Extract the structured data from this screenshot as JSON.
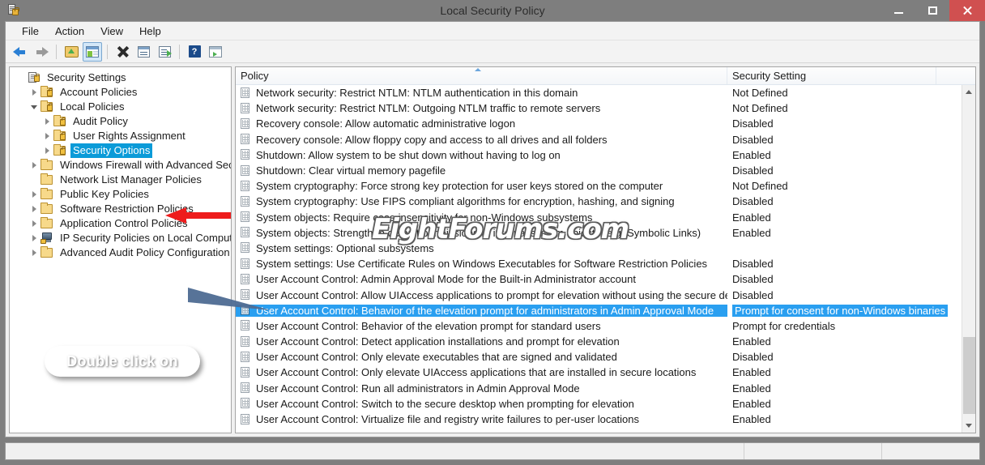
{
  "window": {
    "title": "Local Security Policy",
    "icon": "security-policy-icon",
    "minimize_label": "Minimize",
    "maximize_label": "Maximize",
    "close_label": "Close"
  },
  "menubar": {
    "items": [
      {
        "label": "File"
      },
      {
        "label": "Action"
      },
      {
        "label": "View"
      },
      {
        "label": "Help"
      }
    ]
  },
  "toolbar": {
    "buttons": [
      {
        "name": "back-button",
        "icon": "back-arrow-icon"
      },
      {
        "name": "forward-button",
        "icon": "forward-arrow-icon"
      },
      {
        "name": "up-one-level-button",
        "icon": "folder-up-icon"
      },
      {
        "name": "show-hide-tree-button",
        "icon": "console-tree-icon",
        "pressed": true
      },
      {
        "name": "delete-button",
        "icon": "delete-x-icon"
      },
      {
        "name": "properties-button",
        "icon": "properties-icon"
      },
      {
        "name": "export-list-button",
        "icon": "export-list-icon"
      },
      {
        "name": "help-button",
        "icon": "help-question-icon"
      },
      {
        "name": "new-window-button",
        "icon": "new-window-icon"
      }
    ]
  },
  "tree": {
    "nodes": [
      {
        "label": "Security Settings",
        "depth": 0,
        "twist": "none",
        "icon": "security-settings-icon",
        "selected": false
      },
      {
        "label": "Account Policies",
        "depth": 1,
        "twist": "closed",
        "icon": "policy-folder-icon",
        "selected": false
      },
      {
        "label": "Local Policies",
        "depth": 1,
        "twist": "open",
        "icon": "policy-folder-icon",
        "selected": false
      },
      {
        "label": "Audit Policy",
        "depth": 2,
        "twist": "closed",
        "icon": "policy-folder-icon",
        "selected": false
      },
      {
        "label": "User Rights Assignment",
        "depth": 2,
        "twist": "closed",
        "icon": "policy-folder-icon",
        "selected": false
      },
      {
        "label": "Security Options",
        "depth": 2,
        "twist": "closed",
        "icon": "policy-folder-icon",
        "selected": true
      },
      {
        "label": "Windows Firewall with Advanced Security",
        "depth": 1,
        "twist": "closed",
        "icon": "folder-icon",
        "selected": false
      },
      {
        "label": "Network List Manager Policies",
        "depth": 1,
        "twist": "none",
        "icon": "folder-icon",
        "selected": false
      },
      {
        "label": "Public Key Policies",
        "depth": 1,
        "twist": "closed",
        "icon": "folder-icon",
        "selected": false
      },
      {
        "label": "Software Restriction Policies",
        "depth": 1,
        "twist": "closed",
        "icon": "folder-icon",
        "selected": false
      },
      {
        "label": "Application Control Policies",
        "depth": 1,
        "twist": "closed",
        "icon": "folder-icon",
        "selected": false
      },
      {
        "label": "IP Security Policies on Local Computer",
        "depth": 1,
        "twist": "closed",
        "icon": "computer-key-icon",
        "selected": false
      },
      {
        "label": "Advanced Audit Policy Configuration",
        "depth": 1,
        "twist": "closed",
        "icon": "folder-icon",
        "selected": false
      }
    ]
  },
  "list": {
    "columns": [
      {
        "label": "Policy",
        "sorted": "ascending"
      },
      {
        "label": "Security Setting",
        "sorted": "none"
      }
    ],
    "rows": [
      {
        "policy": "Network security: Restrict NTLM: NTLM authentication in this domain",
        "setting": "Not Defined",
        "selected": false
      },
      {
        "policy": "Network security: Restrict NTLM: Outgoing NTLM traffic to remote servers",
        "setting": "Not Defined",
        "selected": false
      },
      {
        "policy": "Recovery console: Allow automatic administrative logon",
        "setting": "Disabled",
        "selected": false
      },
      {
        "policy": "Recovery console: Allow floppy copy and access to all drives and all folders",
        "setting": "Disabled",
        "selected": false
      },
      {
        "policy": "Shutdown: Allow system to be shut down without having to log on",
        "setting": "Enabled",
        "selected": false
      },
      {
        "policy": "Shutdown: Clear virtual memory pagefile",
        "setting": "Disabled",
        "selected": false
      },
      {
        "policy": "System cryptography: Force strong key protection for user keys stored on the computer",
        "setting": "Not Defined",
        "selected": false
      },
      {
        "policy": "System cryptography: Use FIPS compliant algorithms for encryption, hashing, and signing",
        "setting": "Disabled",
        "selected": false
      },
      {
        "policy": "System objects: Require case insensitivity for non-Windows subsystems",
        "setting": "Enabled",
        "selected": false
      },
      {
        "policy": "System objects: Strengthen default permissions of internal system objects (e.g. Symbolic Links)",
        "setting": "Enabled",
        "selected": false
      },
      {
        "policy": "System settings: Optional subsystems",
        "setting": "",
        "selected": false
      },
      {
        "policy": "System settings: Use Certificate Rules on Windows Executables for Software Restriction Policies",
        "setting": "Disabled",
        "selected": false
      },
      {
        "policy": "User Account Control: Admin Approval Mode for the Built-in Administrator account",
        "setting": "Disabled",
        "selected": false
      },
      {
        "policy": "User Account Control: Allow UIAccess applications to prompt for elevation without using the secure desktop",
        "setting": "Disabled",
        "selected": false
      },
      {
        "policy": "User Account Control: Behavior of the elevation prompt for administrators in Admin Approval Mode",
        "setting": "Prompt for consent for non-Windows binaries",
        "selected": true
      },
      {
        "policy": "User Account Control: Behavior of the elevation prompt for standard users",
        "setting": "Prompt for credentials",
        "selected": false
      },
      {
        "policy": "User Account Control: Detect application installations and prompt for elevation",
        "setting": "Enabled",
        "selected": false
      },
      {
        "policy": "User Account Control: Only elevate executables that are signed and validated",
        "setting": "Disabled",
        "selected": false
      },
      {
        "policy": "User Account Control: Only elevate UIAccess applications that are installed in secure locations",
        "setting": "Enabled",
        "selected": false
      },
      {
        "policy": "User Account Control: Run all administrators in Admin Approval Mode",
        "setting": "Enabled",
        "selected": false
      },
      {
        "policy": "User Account Control: Switch to the secure desktop when prompting for elevation",
        "setting": "Enabled",
        "selected": false
      },
      {
        "policy": "User Account Control: Virtualize file and registry write failures to per-user locations",
        "setting": "Enabled",
        "selected": false
      }
    ]
  },
  "annotations": {
    "callout_text": "Double click on",
    "watermark_text": "EightForums.com",
    "red_arrow": "red-left-arrow-icon",
    "accent_selection": "#2a9ff0",
    "tree_selection": "#0b9bd8",
    "callout_color": "#4e6b92",
    "arrow_color": "#ee1c1c"
  },
  "statusbar": {
    "panes": [
      "",
      "",
      ""
    ]
  },
  "scrollbar": {
    "up_label": "Scroll up",
    "down_label": "Scroll down"
  }
}
